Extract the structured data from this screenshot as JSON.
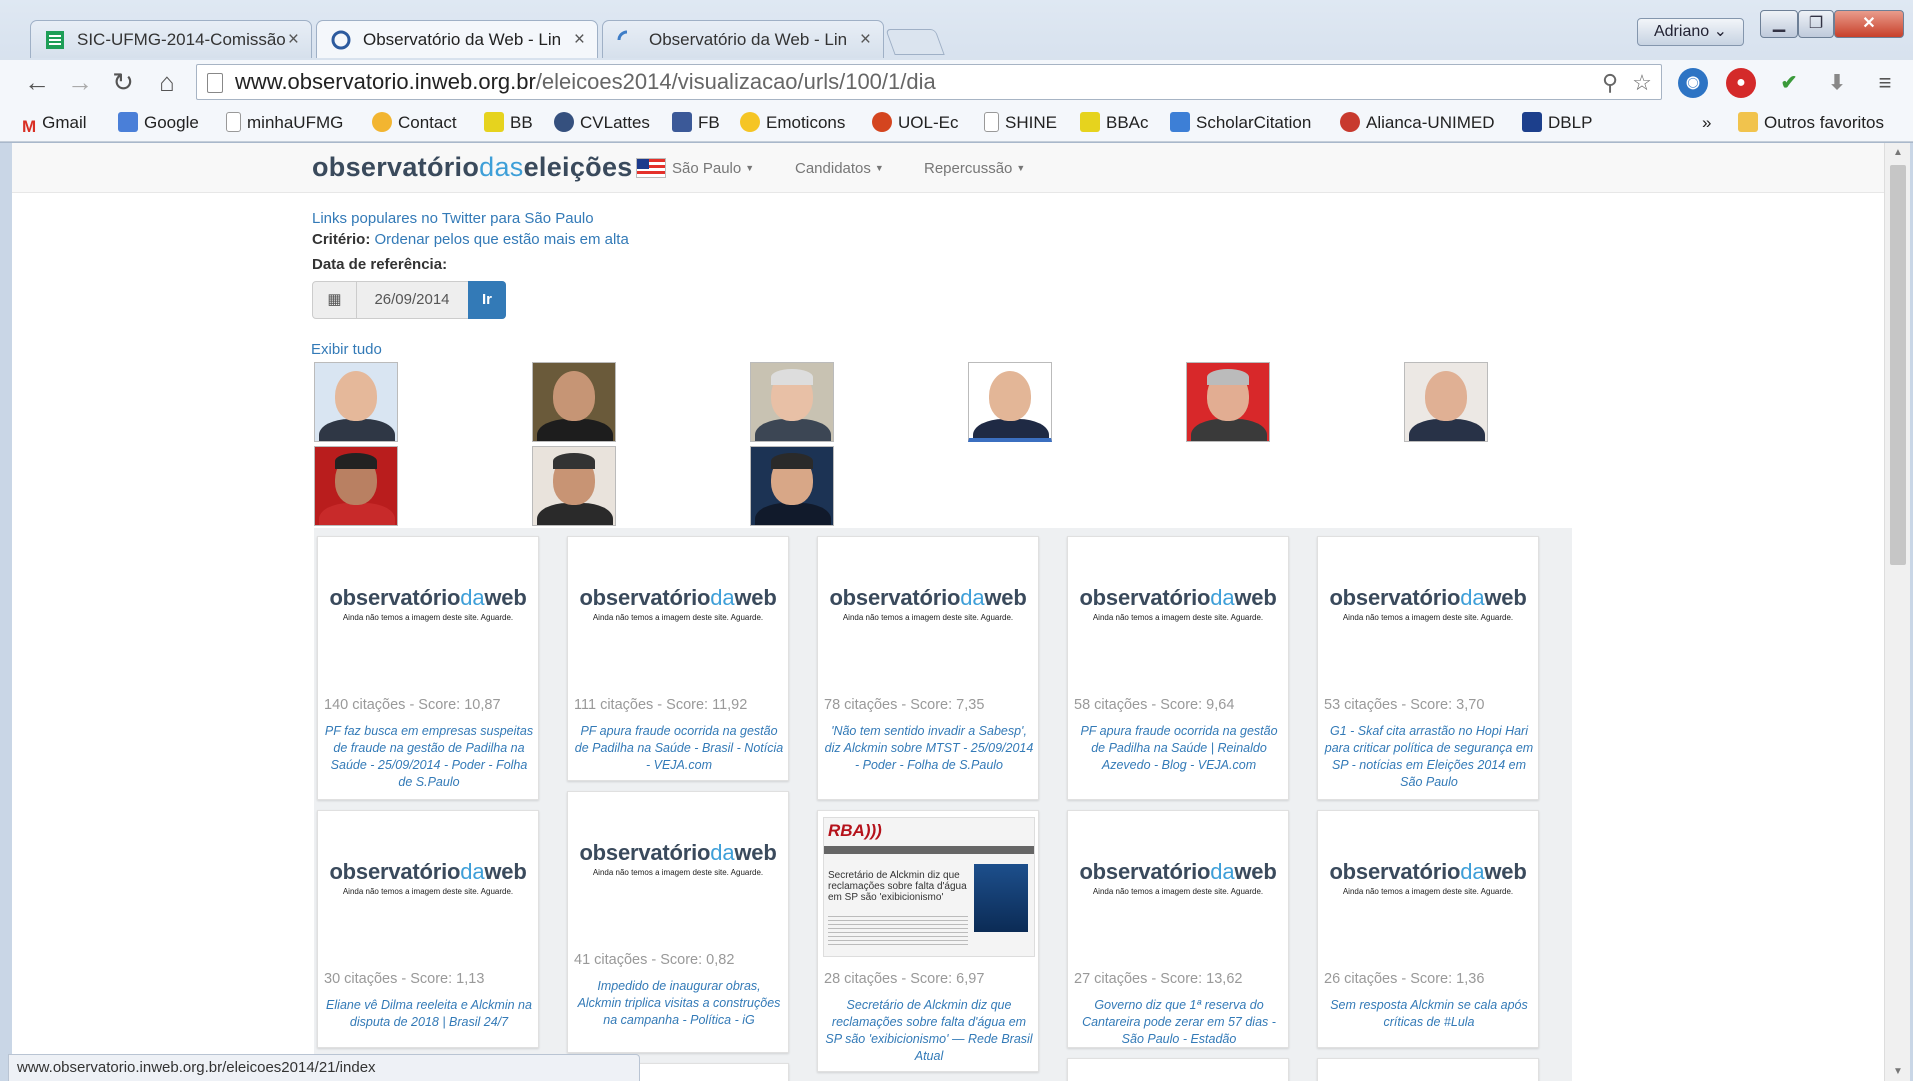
{
  "tabs": [
    {
      "title": "SIC-UFMG-2014-Comissão",
      "active": false
    },
    {
      "title": "Observatório da Web - Lin",
      "active": true
    },
    {
      "title": "Observatório da Web - Lin",
      "active": false
    }
  ],
  "profile": "Adriano",
  "address": {
    "host": "www.observatorio.inweb.org.br",
    "path": "/eleicoes2014/visualizacao/urls/100/1/dia"
  },
  "bookmarks": [
    "Gmail",
    "Google",
    "minhaUFMG",
    "Contact",
    "BB",
    "CVLattes",
    "FB",
    "Emoticons",
    "UOL-Ec",
    "SHINE",
    "BBAc",
    "ScholarCitation",
    "Alianca-UNIMED",
    "DBLP"
  ],
  "bookmarks_more": "»",
  "bookmarks_other": "Outros favoritos",
  "site": {
    "brand_a": "observatório",
    "brand_b": "das",
    "brand_c": "eleições",
    "nav": {
      "state": "São Paulo",
      "candidates": "Candidatos",
      "repercussion": "Repercussão"
    }
  },
  "intro": {
    "line1_a": "Links populares no Twitter para",
    "line1_b": "São Paulo",
    "criteria_label": "Critério:",
    "criteria_value": "Ordenar pelos que estão mais em alta",
    "date_label": "Data de referência:",
    "date_value": "26/09/2014",
    "go": "Ir",
    "show_all": "Exibir tudo"
  },
  "placeholder": {
    "a": "observatório",
    "b": "da",
    "c": "web",
    "sub": "Ainda não temos a imagem deste site. Aguarde."
  },
  "cards": [
    {
      "meta": "140 citações - Score: 10,87",
      "title": "PF faz busca em empresas suspeitas de fraude na gestão de Padilha na Saúde - 25/09/2014 - Poder - Folha de S.Paulo"
    },
    {
      "meta": "111 citações - Score: 11,92",
      "title": "PF apura fraude ocorrida na gestão de Padilha na Saúde - Brasil - Notícia - VEJA.com"
    },
    {
      "meta": "78 citações - Score: 7,35",
      "title": "'Não tem sentido invadir a Sabesp', diz Alckmin sobre MTST - 25/09/2014 - Poder - Folha de S.Paulo"
    },
    {
      "meta": "58 citações - Score: 9,64",
      "title": "PF apura fraude ocorrida na gestão de Padilha na Saúde | Reinaldo Azevedo - Blog - VEJA.com"
    },
    {
      "meta": "53 citações - Score: 3,70",
      "title": "G1 - Skaf cita arrastão no Hopi Hari para criticar política de segurança em SP - notícias em Eleições 2014 em São Paulo"
    },
    {
      "meta": "30 citações - Score: 1,13",
      "title": "Eliane vê Dilma reeleita e Alckmin na disputa de 2018 | Brasil 24/7"
    },
    {
      "meta": "41 citações - Score: 0,82",
      "title": "Impedido de inaugurar obras, Alckmin triplica visitas a construções na campanha - Política - iG"
    },
    {
      "meta": "28 citações - Score: 6,97",
      "title": "Secretário de Alckmin diz que reclamações sobre falta d'água em SP são 'exibicionismo' — Rede Brasil Atual"
    },
    {
      "meta": "27 citações - Score: 13,62",
      "title": "Governo diz que 1ª reserva do Cantareira pode zerar em 57 dias - São Paulo - Estadão"
    },
    {
      "meta": "26 citações - Score: 1,36",
      "title": "Sem resposta Alckmin se cala após críticas de #Lula"
    }
  ],
  "rba_thumb": {
    "logo": "RBA)))",
    "caption": "Secretário de Alckmin diz que reclamações sobre falta d'água em SP são 'exibicionismo'"
  },
  "status_url": "www.observatorio.inweb.org.br/eleicoes2014/21/index"
}
